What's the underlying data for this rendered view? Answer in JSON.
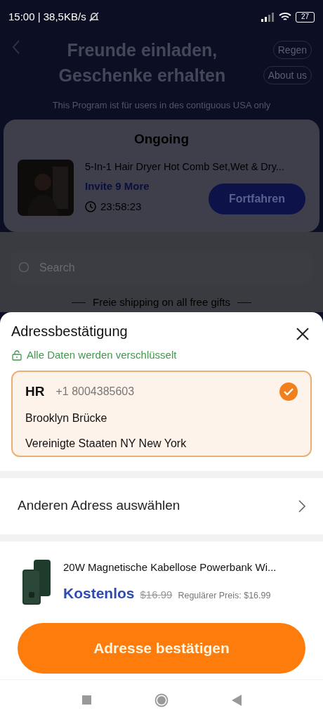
{
  "status_bar": {
    "time": "15:00 | 38,5KB/s",
    "battery": "27"
  },
  "background": {
    "title_lines": [
      "Freunde einladen,",
      "Geschenke erhalten"
    ],
    "header_buttons": [
      "Regen",
      "About us"
    ],
    "notice": "This Program ist für users in des contiguous USA only",
    "ongoing": {
      "title": "Ongoing",
      "product_name": "5-In-1 Hair Dryer Hot Comb Set,Wet & Dry...",
      "invite": "Invite 9 More",
      "timer": "23:58:23",
      "button": "Fortfahren"
    },
    "search": {
      "placeholder": "Search"
    },
    "shipping_banner": "Freie shipping on all free gifts"
  },
  "sheet": {
    "title": "Adressbestätigung",
    "secure_note": "Alle Daten werden verschlüsselt",
    "address": {
      "name": "HR",
      "phone": "+1 8004385603",
      "street": "Brooklyn Brücke",
      "region": "Vereinigte Staaten NY New York",
      "selected": true
    },
    "other_address": "Anderen Adress auswählen",
    "product": {
      "name": "20W Magnetische Kabellose Powerbank Wi...",
      "price": "Kostenlos",
      "old_price": "$16.99",
      "regular_price": "Regulärer Preis: $16.99"
    },
    "confirm_button": "Adresse bestätigen"
  }
}
